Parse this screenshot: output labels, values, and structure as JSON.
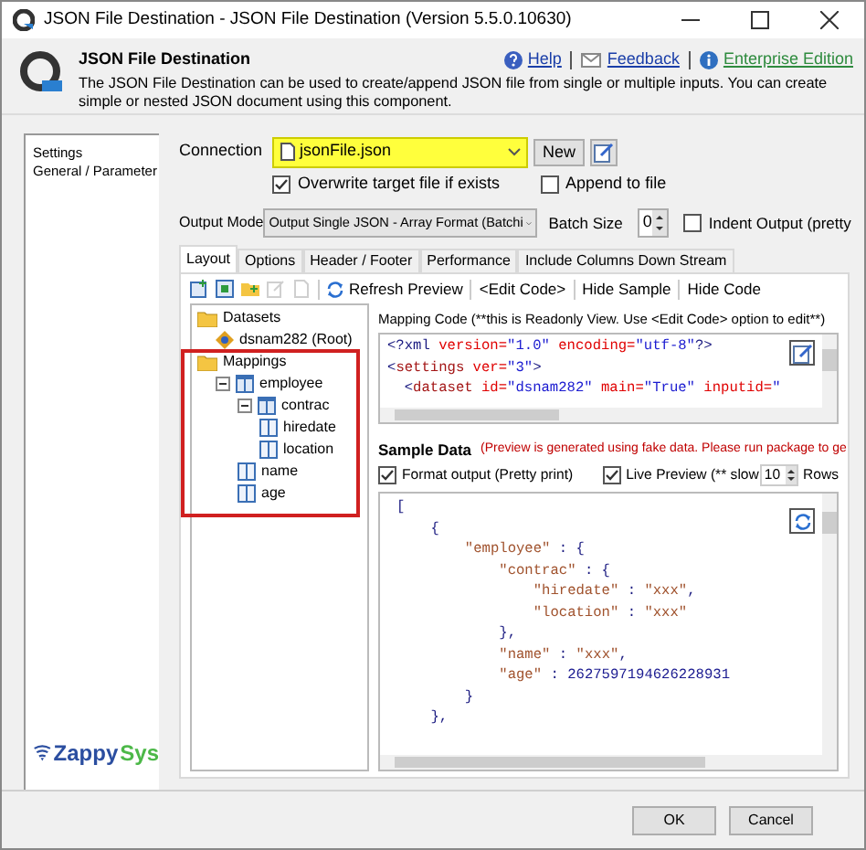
{
  "window": {
    "title": "JSON File Destination - JSON File Destination (Version 5.5.0.10630)"
  },
  "header": {
    "title": "JSON File Destination",
    "description": "The JSON File Destination can be used to create/append JSON file from single or multiple inputs. You can create simple or nested JSON document using this component.",
    "links": [
      {
        "label": "Help",
        "kind": "help"
      },
      {
        "label": "Feedback",
        "kind": "feedback"
      },
      {
        "label": "Enterprise Edition",
        "kind": "edition"
      }
    ]
  },
  "sidebar": {
    "items": [
      "Settings",
      "General / Parameter"
    ]
  },
  "logo": {
    "parts": [
      "Zappy",
      "Sys"
    ]
  },
  "connection": {
    "label": "Connection",
    "value": "jsonFile.json",
    "new_button": "New"
  },
  "options": [
    {
      "label": "Overwrite target file if exists",
      "checked": true
    },
    {
      "label": "Append to file",
      "checked": false
    }
  ],
  "output_mode": {
    "label": "Output Mode",
    "value": "Output Single JSON - Array Format (Batchi"
  },
  "batch_size": {
    "label": "Batch Size",
    "value": "0"
  },
  "indent_output": {
    "label": "Indent Output (pretty",
    "checked": false
  },
  "tabs": [
    {
      "label": "Layout",
      "selected": true
    },
    {
      "label": "Options",
      "selected": false
    },
    {
      "label": "Header / Footer",
      "selected": false
    },
    {
      "label": "Performance",
      "selected": false
    },
    {
      "label": "Include Columns Down Stream",
      "selected": false
    }
  ],
  "toolbar": {
    "buttons": [
      "Refresh Preview",
      "<Edit Code>",
      "Hide Sample",
      "Hide Code"
    ]
  },
  "tree": [
    {
      "label": "Datasets",
      "kind": "folder",
      "children": [
        {
          "label": "dsnam282 (Root)",
          "kind": "dataset"
        }
      ]
    },
    {
      "label": "Mappings",
      "kind": "folder",
      "children": [
        {
          "label": "employee",
          "kind": "object",
          "expanded": true,
          "children": [
            {
              "label": "contrac",
              "kind": "object",
              "expanded": true,
              "children": [
                {
                  "label": "hiredate",
                  "kind": "field"
                },
                {
                  "label": "location",
                  "kind": "field"
                }
              ]
            },
            {
              "label": "name",
              "kind": "field"
            },
            {
              "label": "age",
              "kind": "field"
            }
          ]
        }
      ]
    }
  ],
  "mapping_code": {
    "label": "Mapping Code (**this is Readonly View. Use <Edit Code> option to edit**)",
    "lines": [
      [
        {
          "t": "<?xml",
          "kind": "punct"
        },
        {
          "t": " version=",
          "kind": "attr"
        },
        {
          "t": "\"1.0\"",
          "kind": "value"
        },
        {
          "t": " encoding=",
          "kind": "attr"
        },
        {
          "t": "\"utf-8\"",
          "kind": "value"
        },
        {
          "t": "?>",
          "kind": "punct"
        }
      ],
      [
        {
          "t": "<",
          "kind": "punct"
        },
        {
          "t": "settings",
          "kind": "tag"
        },
        {
          "t": " ver=",
          "kind": "attr"
        },
        {
          "t": "\"3\"",
          "kind": "value"
        },
        {
          "t": ">",
          "kind": "punct"
        }
      ],
      [
        {
          "t": "  <",
          "kind": "punct"
        },
        {
          "t": "dataset",
          "kind": "tag"
        },
        {
          "t": " id=",
          "kind": "attr"
        },
        {
          "t": "\"dsnam282\"",
          "kind": "value"
        },
        {
          "t": " main=",
          "kind": "attr"
        },
        {
          "t": "\"True\"",
          "kind": "value"
        },
        {
          "t": " inputid=",
          "kind": "attr"
        },
        {
          "t": "\"",
          "kind": "value"
        }
      ]
    ]
  },
  "sample_data": {
    "title": "Sample Data",
    "note": "(Preview is generated using fake data. Please run package to ge",
    "format_output": {
      "label": "Format output (Pretty print)",
      "checked": true
    },
    "live_preview": {
      "label": "Live Preview (** slow",
      "checked": true
    },
    "rows": {
      "value": "10",
      "label": "Rows"
    },
    "lines": [
      [
        {
          "t": "[",
          "kind": "punct"
        }
      ],
      [
        {
          "t": "    {",
          "kind": "punct"
        }
      ],
      [
        {
          "t": "        \"employee\"",
          "kind": "key"
        },
        {
          "t": " : {",
          "kind": "punct"
        }
      ],
      [
        {
          "t": "            \"contrac\"",
          "kind": "key"
        },
        {
          "t": " : {",
          "kind": "punct"
        }
      ],
      [
        {
          "t": "                \"hiredate\"",
          "kind": "key"
        },
        {
          "t": " : ",
          "kind": "punct"
        },
        {
          "t": "\"xxx\"",
          "kind": "string"
        },
        {
          "t": ",",
          "kind": "punct"
        }
      ],
      [
        {
          "t": "                \"location\"",
          "kind": "key"
        },
        {
          "t": " : ",
          "kind": "punct"
        },
        {
          "t": "\"xxx\"",
          "kind": "string"
        }
      ],
      [
        {
          "t": "            },",
          "kind": "punct"
        }
      ],
      [
        {
          "t": "            \"name\"",
          "kind": "key"
        },
        {
          "t": " : ",
          "kind": "punct"
        },
        {
          "t": "\"xxx\"",
          "kind": "string"
        },
        {
          "t": ",",
          "kind": "punct"
        }
      ],
      [
        {
          "t": "            \"age\"",
          "kind": "key"
        },
        {
          "t": " : ",
          "kind": "punct"
        },
        {
          "t": "2627597194626228931",
          "kind": "number"
        }
      ],
      [
        {
          "t": "        }",
          "kind": "punct"
        }
      ],
      [
        {
          "t": "    },",
          "kind": "punct"
        }
      ]
    ]
  },
  "buttons": [
    "OK",
    "Cancel"
  ]
}
